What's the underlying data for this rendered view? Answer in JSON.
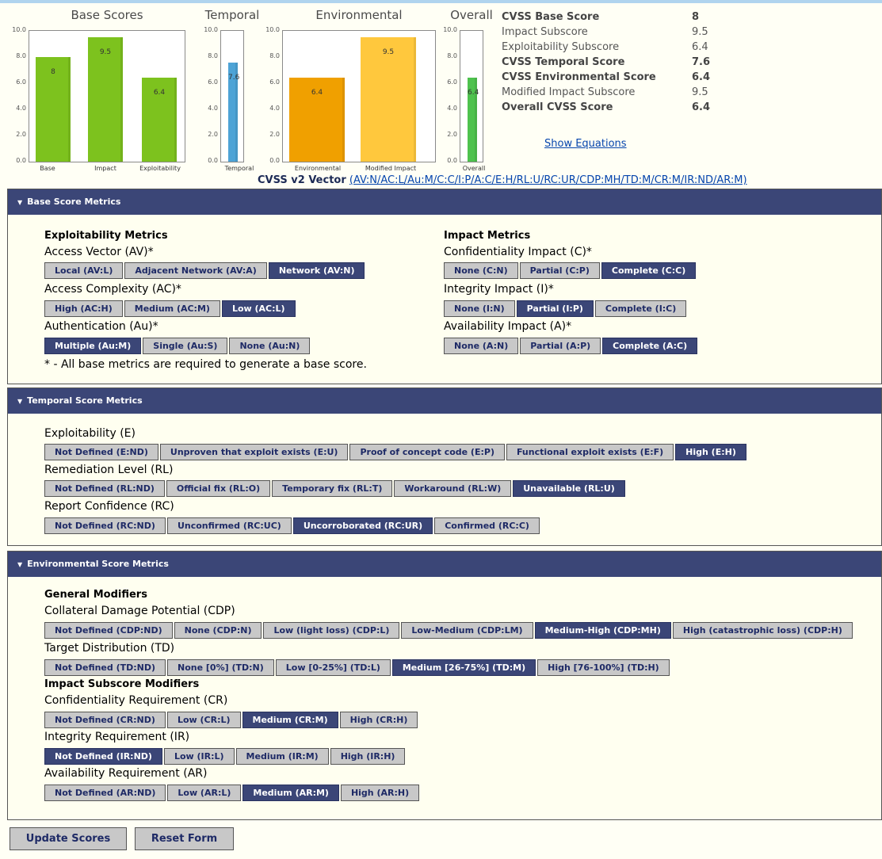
{
  "chart_data": [
    {
      "type": "bar",
      "title": "Base Scores",
      "categories": [
        "Base",
        "Impact",
        "Exploitability"
      ],
      "values": [
        8.0,
        9.5,
        6.4
      ],
      "ylim": [
        0,
        10
      ],
      "yticks": [
        "10.0",
        "8.0",
        "6.0",
        "4.0",
        "2.0",
        "0.0"
      ],
      "colors": [
        "#7dc21e",
        "#7dc21e",
        "#7dc21e"
      ]
    },
    {
      "type": "bar",
      "title": "Temporal",
      "categories": [
        "Temporal"
      ],
      "values": [
        7.6
      ],
      "ylim": [
        0,
        10
      ],
      "yticks": [
        "10.0",
        "8.0",
        "6.0",
        "4.0",
        "2.0",
        "0.0"
      ],
      "colors": [
        "#4da3d6"
      ]
    },
    {
      "type": "bar",
      "title": "Environmental",
      "categories": [
        "Environmental",
        "Modified Impact"
      ],
      "values": [
        6.4,
        9.5
      ],
      "ylim": [
        0,
        10
      ],
      "yticks": [
        "10.0",
        "8.0",
        "6.0",
        "4.0",
        "2.0",
        "0.0"
      ],
      "colors": [
        "#f0a000",
        "#ffc83d"
      ]
    },
    {
      "type": "bar",
      "title": "Overall",
      "categories": [
        "Overall"
      ],
      "values": [
        6.4
      ],
      "ylim": [
        0,
        10
      ],
      "yticks": [
        "10.0",
        "8.0",
        "6.0",
        "4.0",
        "2.0",
        "0.0"
      ],
      "colors": [
        "#4ec24e"
      ]
    }
  ],
  "summary": [
    {
      "label": "CVSS Base Score",
      "value": "8",
      "bold": true
    },
    {
      "label": "Impact Subscore",
      "value": "9.5",
      "bold": false
    },
    {
      "label": "Exploitability Subscore",
      "value": "6.4",
      "bold": false
    },
    {
      "label": "CVSS Temporal Score",
      "value": "7.6",
      "bold": true
    },
    {
      "label": "CVSS Environmental Score",
      "value": "6.4",
      "bold": true
    },
    {
      "label": "Modified Impact Subscore",
      "value": "9.5",
      "bold": false
    },
    {
      "label": "Overall CVSS Score",
      "value": "6.4",
      "bold": true
    }
  ],
  "show_equations": "Show Equations",
  "vector_label": "CVSS v2 Vector",
  "vector_link": "(AV:N/AC:L/Au:M/C:C/I:P/A:C/E:H/RL:U/RC:UR/CDP:MH/TD:M/CR:M/IR:ND/AR:M)",
  "base_panel": {
    "title": "Base Score Metrics",
    "exploitability_title": "Exploitability Metrics",
    "impact_title": "Impact Metrics",
    "required_note": "* - All base metrics are required to generate a base score.",
    "access_vector": {
      "label": "Access Vector (AV)*",
      "options": [
        "Local (AV:L)",
        "Adjacent Network (AV:A)",
        "Network (AV:N)"
      ],
      "selected": 2
    },
    "access_complexity": {
      "label": "Access Complexity (AC)*",
      "options": [
        "High (AC:H)",
        "Medium (AC:M)",
        "Low (AC:L)"
      ],
      "selected": 2
    },
    "authentication": {
      "label": "Authentication (Au)*",
      "options": [
        "Multiple (Au:M)",
        "Single (Au:S)",
        "None (Au:N)"
      ],
      "selected": 0
    },
    "confidentiality": {
      "label": "Confidentiality Impact (C)*",
      "options": [
        "None (C:N)",
        "Partial (C:P)",
        "Complete (C:C)"
      ],
      "selected": 2
    },
    "integrity": {
      "label": "Integrity Impact (I)*",
      "options": [
        "None (I:N)",
        "Partial (I:P)",
        "Complete (I:C)"
      ],
      "selected": 1
    },
    "availability": {
      "label": "Availability Impact (A)*",
      "options": [
        "None (A:N)",
        "Partial (A:P)",
        "Complete (A:C)"
      ],
      "selected": 2
    }
  },
  "temporal_panel": {
    "title": "Temporal Score Metrics",
    "exploitability": {
      "label": "Exploitability (E)",
      "options": [
        "Not Defined (E:ND)",
        "Unproven that exploit exists (E:U)",
        "Proof of concept code (E:P)",
        "Functional exploit exists (E:F)",
        "High (E:H)"
      ],
      "selected": 4
    },
    "remediation": {
      "label": "Remediation Level (RL)",
      "options": [
        "Not Defined (RL:ND)",
        "Official fix (RL:O)",
        "Temporary fix (RL:T)",
        "Workaround (RL:W)",
        "Unavailable (RL:U)"
      ],
      "selected": 4
    },
    "confidence": {
      "label": "Report Confidence (RC)",
      "options": [
        "Not Defined (RC:ND)",
        "Unconfirmed (RC:UC)",
        "Uncorroborated (RC:UR)",
        "Confirmed (RC:C)"
      ],
      "selected": 2
    }
  },
  "env_panel": {
    "title": "Environmental Score Metrics",
    "general_title": "General Modifiers",
    "impact_title": "Impact Subscore Modifiers",
    "cdp": {
      "label": "Collateral Damage Potential (CDP)",
      "options": [
        "Not Defined (CDP:ND)",
        "None (CDP:N)",
        "Low (light loss) (CDP:L)",
        "Low-Medium (CDP:LM)",
        "Medium-High (CDP:MH)",
        "High (catastrophic loss) (CDP:H)"
      ],
      "selected": 4
    },
    "td": {
      "label": "Target Distribution (TD)",
      "options": [
        "Not Defined (TD:ND)",
        "None [0%] (TD:N)",
        "Low [0-25%] (TD:L)",
        "Medium [26-75%] (TD:M)",
        "High [76-100%] (TD:H)"
      ],
      "selected": 3
    },
    "cr": {
      "label": "Confidentiality Requirement (CR)",
      "options": [
        "Not Defined (CR:ND)",
        "Low (CR:L)",
        "Medium (CR:M)",
        "High (CR:H)"
      ],
      "selected": 2
    },
    "ir": {
      "label": "Integrity Requirement (IR)",
      "options": [
        "Not Defined (IR:ND)",
        "Low (IR:L)",
        "Medium (IR:M)",
        "High (IR:H)"
      ],
      "selected": 0
    },
    "ar": {
      "label": "Availability Requirement (AR)",
      "options": [
        "Not Defined (AR:ND)",
        "Low (AR:L)",
        "Medium (AR:M)",
        "High (AR:H)"
      ],
      "selected": 2
    }
  },
  "actions": {
    "update": "Update Scores",
    "reset": "Reset Form"
  }
}
